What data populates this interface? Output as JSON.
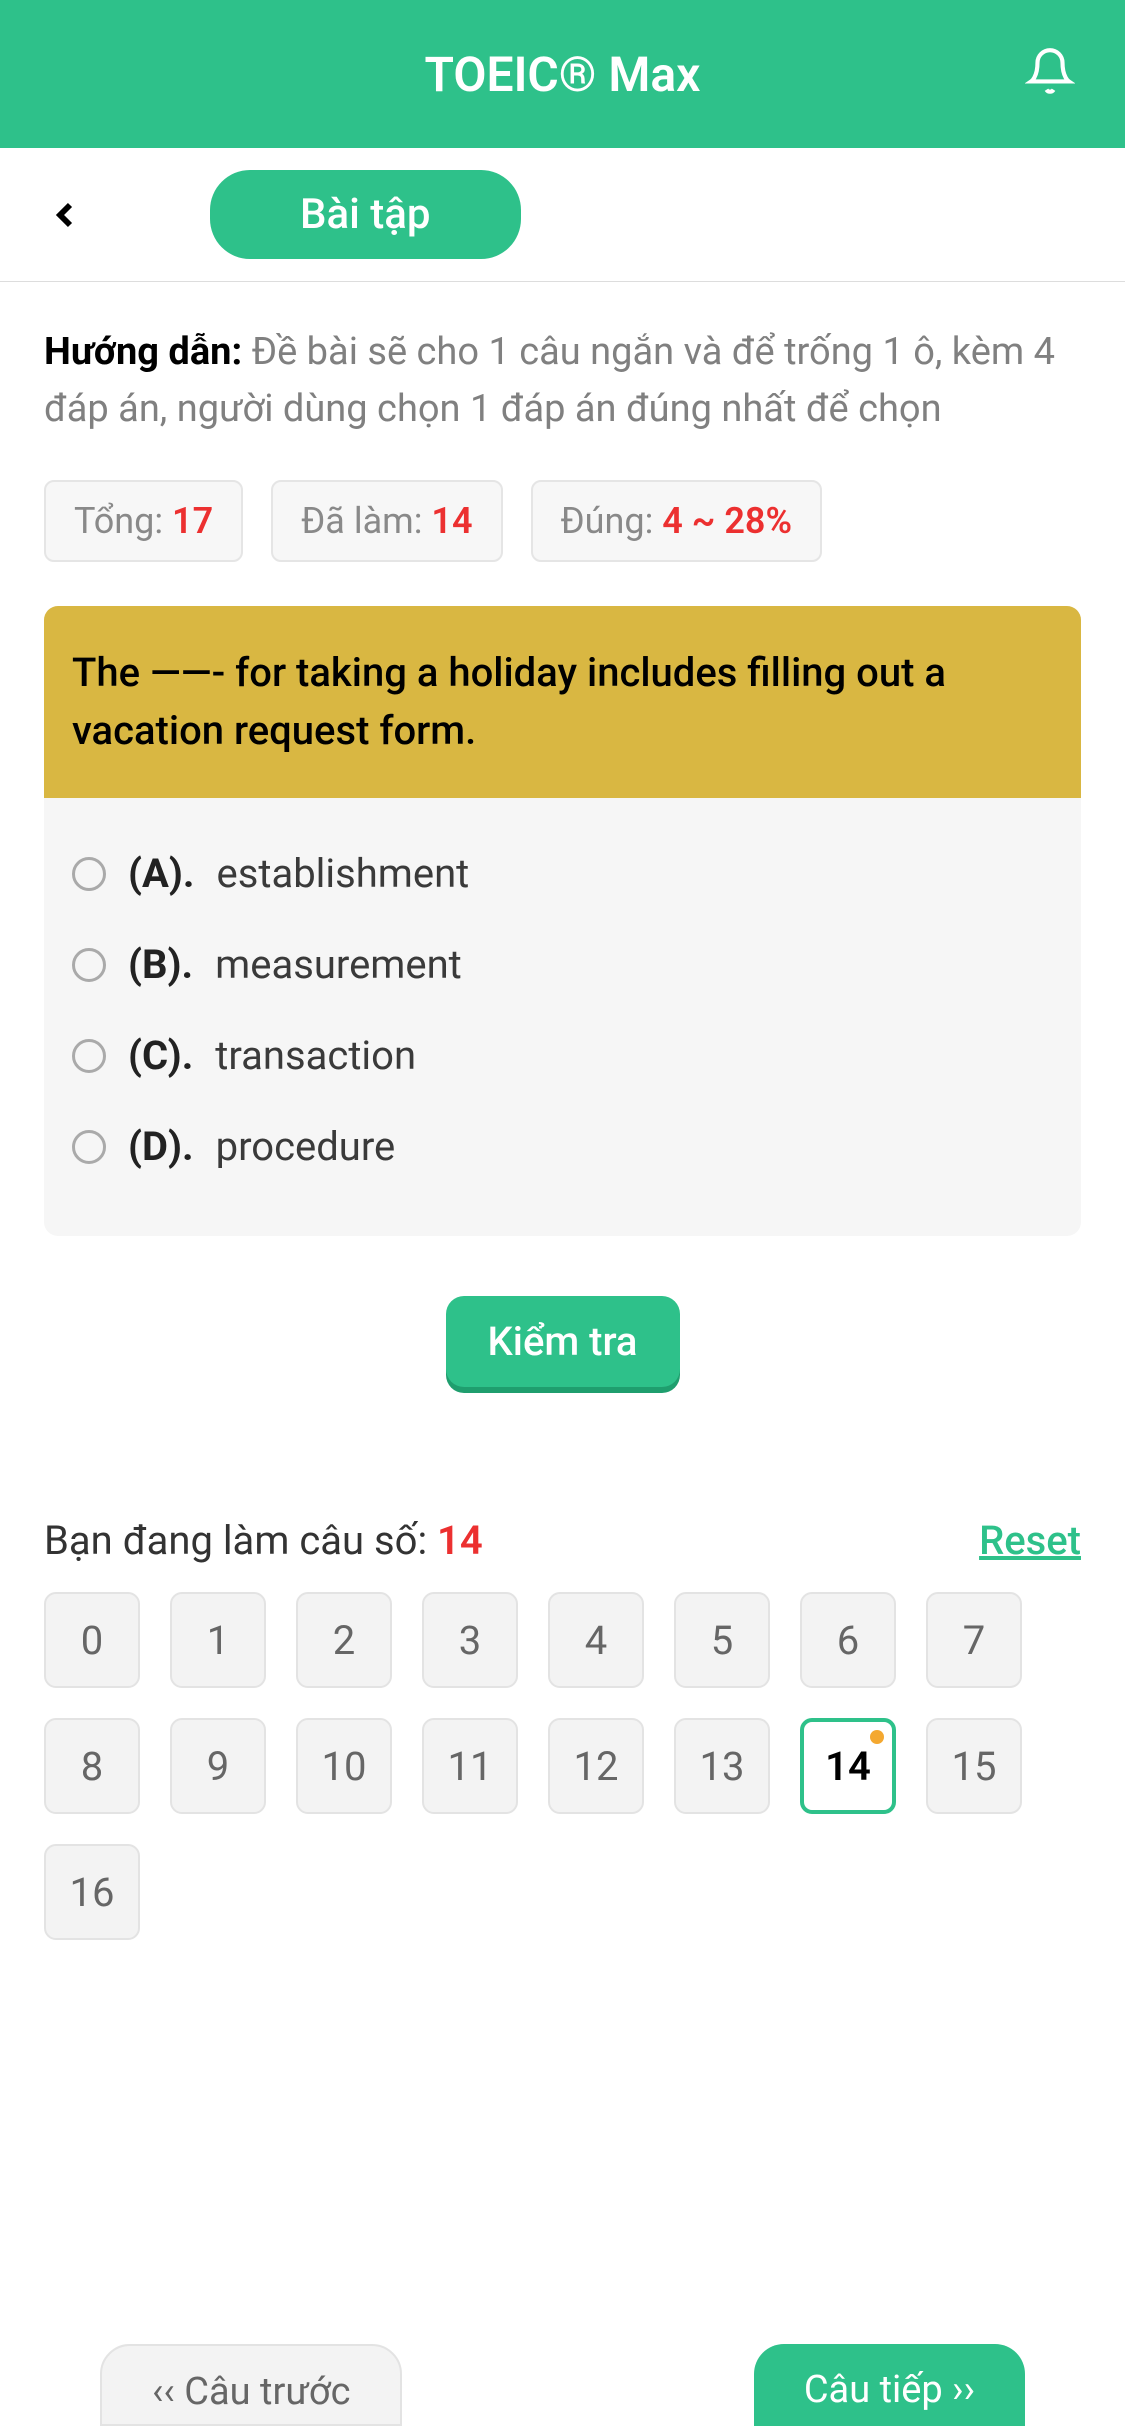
{
  "header": {
    "title": "TOEIC® Max"
  },
  "nav": {
    "tab": "Bài tập"
  },
  "instruction": {
    "label": "Hướng dẫn: ",
    "text": "Đề bài sẽ cho 1 câu ngắn và để trống 1 ô, kèm 4 đáp án, người dùng chọn 1 đáp án đúng nhất để chọn"
  },
  "stats": {
    "total_label": "Tổng: ",
    "total_value": "17",
    "done_label": "Đã làm: ",
    "done_value": "14",
    "correct_label": "Đúng: ",
    "correct_value": "4 ~ 28%"
  },
  "question": {
    "text": "The ——- for taking a holiday includes filling out a vacation request form.",
    "options": [
      {
        "label": "(A).",
        "text": "establishment"
      },
      {
        "label": "(B).",
        "text": "measurement"
      },
      {
        "label": "(C).",
        "text": "transaction"
      },
      {
        "label": "(D).",
        "text": "procedure"
      }
    ]
  },
  "check_btn": "Kiểm tra",
  "progress": {
    "label": "Bạn đang làm câu số: ",
    "current": "14",
    "reset": "Reset",
    "numbers": [
      "0",
      "1",
      "2",
      "3",
      "4",
      "5",
      "6",
      "7",
      "8",
      "9",
      "10",
      "11",
      "12",
      "13",
      "14",
      "15",
      "16"
    ],
    "active_index": 14
  },
  "footer": {
    "prev": "‹‹ Câu trước",
    "next": "Câu tiếp ››"
  }
}
